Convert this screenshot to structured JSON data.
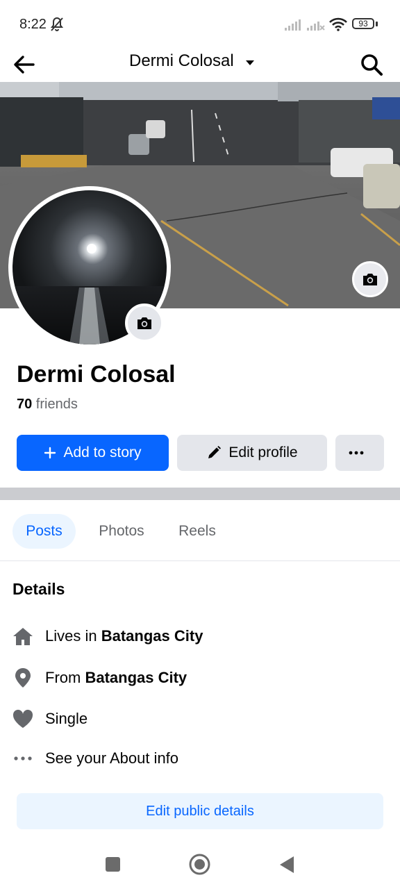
{
  "status": {
    "time": "8:22",
    "battery": "93"
  },
  "header": {
    "title": "Dermi Colosal"
  },
  "profile": {
    "name": "Dermi Colosal",
    "friends_count": "70",
    "friends_label": " friends"
  },
  "actions": {
    "add_story": "Add to story",
    "edit_profile": "Edit profile",
    "more": "more-icon"
  },
  "tabs": [
    {
      "label": "Posts"
    },
    {
      "label": "Photos"
    },
    {
      "label": "Reels"
    }
  ],
  "details": {
    "title": "Details",
    "lives_prefix": "Lives in ",
    "lives_value": "Batangas City",
    "from_prefix": "From ",
    "from_value": "Batangas City",
    "relationship": "Single",
    "about": "See your About info",
    "edit_button": "Edit public details"
  },
  "colors": {
    "primary": "#0866ff",
    "primary_light": "#ebf5ff",
    "secondary_button": "#e4e6eb",
    "muted_text": "#65676b"
  },
  "icons": [
    "bell-off-icon",
    "signal-icon",
    "wifi-icon",
    "battery-icon",
    "back-arrow-icon",
    "caret-down-icon",
    "search-icon",
    "camera-icon",
    "plus-icon",
    "pencil-icon",
    "more-icon",
    "home-icon",
    "location-pin-icon",
    "heart-icon",
    "ellipsis-icon"
  ]
}
